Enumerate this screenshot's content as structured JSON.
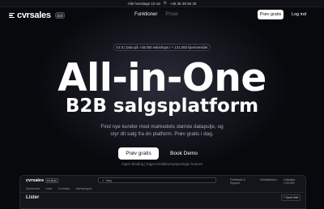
{
  "topbar": {
    "hours": "Alle hverdage 10-16",
    "phone_icon": "phone-icon",
    "phone": "+45 36 39 56 30"
  },
  "nav": {
    "logo_text": "cvrsales",
    "logo_badge": "2.0",
    "menu": [
      "Funktioner",
      "Priser"
    ],
    "cta": "Prøv gratis",
    "login": "Log ind"
  },
  "hero": {
    "pill": "V2.0 | Data på +28.000 webshops / + 131.000 hjemmesider",
    "title": "All-in-One",
    "subtitle": "B2B salgsplatform",
    "description": "Find nye kunder med markedets største datapulje, og styr dit salg fra én platform. Prøv gratis i dag.",
    "primary_cta": "Prøv gratis",
    "secondary_cta": "Book Demo",
    "note": "Ingen binding | Ingen kreditkortoplysninger krævet"
  },
  "preview": {
    "logo": "cvrsales",
    "logo_badge": "2.0 Beta",
    "search_value": "Søg",
    "right_links": [
      "Feedback & Support",
      "Vikaftestnavn",
      "Indbakke: 1,00,000"
    ],
    "tabs": [
      "Dashboard",
      "Lister",
      "Kontakter",
      "Markedsgraf"
    ],
    "page_title": "Lister",
    "button": "+ Opret liste"
  },
  "colors": {
    "background": "#08090d",
    "button_bg": "#ffffff",
    "muted_text": "#a8abb6"
  }
}
